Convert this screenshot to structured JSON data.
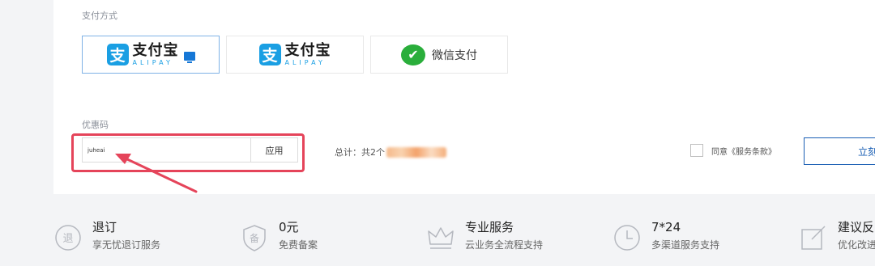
{
  "payment": {
    "section_label": "支付方式",
    "options": [
      {
        "cn": "支付宝",
        "en": "ALIPAY"
      },
      {
        "cn": "支付宝",
        "en": "ALIPAY"
      },
      {
        "label": "微信支付"
      }
    ]
  },
  "coupon": {
    "section_label": "优惠码",
    "value": "juheai",
    "apply_label": "应用"
  },
  "order": {
    "total_label": "总计：共2",
    "total_suffix": "个"
  },
  "agreement": {
    "label": "同意《服务条款》"
  },
  "buy_button": {
    "label": "立刻"
  },
  "features": [
    {
      "title": "退订",
      "subtitle": "享无忧退订服务",
      "icon": "refund-icon",
      "icon_char": "退"
    },
    {
      "title": "0元",
      "subtitle": "免费备案",
      "icon": "shield-icon",
      "icon_char": "备"
    },
    {
      "title": "专业服务",
      "subtitle": "云业务全流程支持",
      "icon": "crown-icon"
    },
    {
      "title": "7*24",
      "subtitle": "多渠道服务支持",
      "icon": "clock-icon"
    },
    {
      "title": "建议反",
      "subtitle": "优化改进",
      "icon": "edit-icon"
    }
  ],
  "colors": {
    "accent": "#1a5fb4",
    "alipay": "#1a9fe3",
    "wechat": "#2aae3b",
    "highlight": "#e5445a"
  }
}
